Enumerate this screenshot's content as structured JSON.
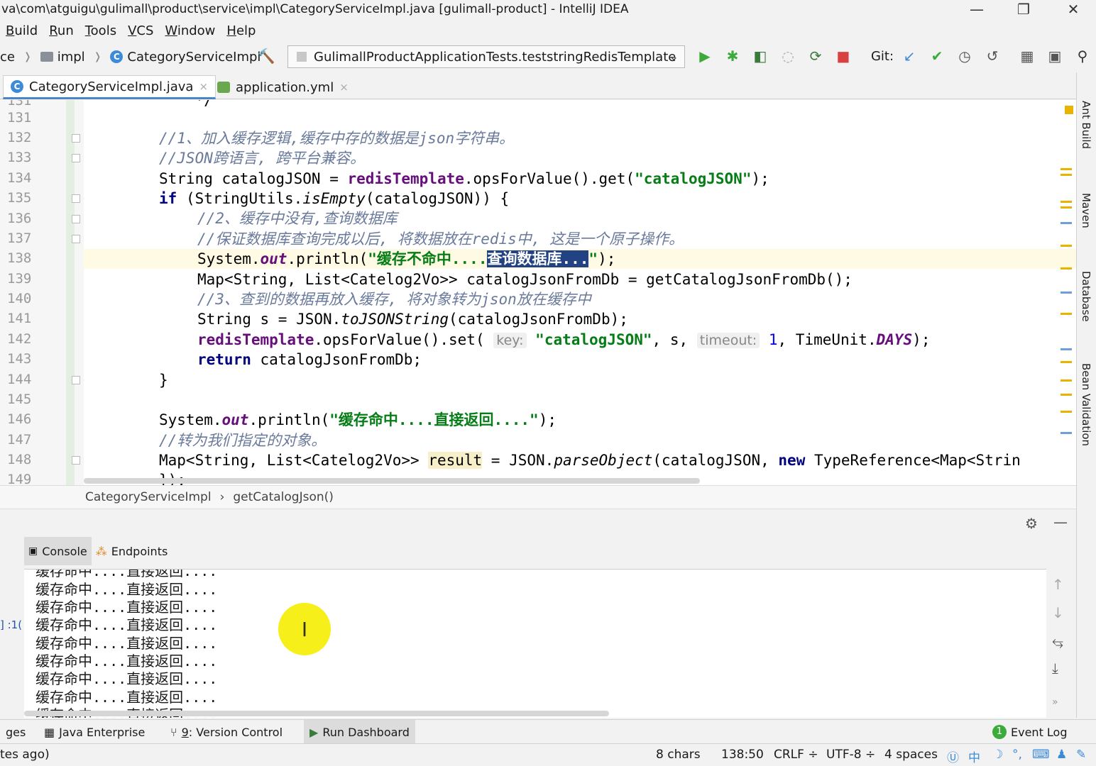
{
  "window": {
    "title": "va\\com\\atguigu\\gulimall\\product\\service\\impl\\CategoryServiceImpl.java [gulimall-product] - IntelliJ IDEA",
    "controls": [
      "—",
      "❐",
      "✕"
    ]
  },
  "menu": [
    {
      "key": "B",
      "rest": "uild"
    },
    {
      "key": "R",
      "rest": "un"
    },
    {
      "key": "T",
      "rest": "ools"
    },
    {
      "key": "V",
      "rest": "CS"
    },
    {
      "key": "W",
      "rest": "indow"
    },
    {
      "key": "H",
      "rest": "elp"
    }
  ],
  "nav": {
    "crumb_prefix": "ce",
    "folder": "impl",
    "class_icon": "C",
    "class": "CategoryServiceImpl",
    "run_config": "GulimallProductApplicationTests.teststringRedisTemplate",
    "git_label": "Git:"
  },
  "tabs": {
    "active": "CategoryServiceImpl.java",
    "second": "application.yml",
    "close": "×"
  },
  "editor": {
    "line_numbers": [
      "131",
      "132",
      "133",
      "134",
      "135",
      "136",
      "137",
      "138",
      "139",
      "140",
      "141",
      "142",
      "143",
      "144",
      "145",
      "146",
      "147",
      "148",
      "149"
    ],
    "l131": "    */",
    "l132": "//1、加入缓存逻辑,缓存中存的数据是json字符串。",
    "l133": "//JSON跨语言, 跨平台兼容。",
    "l134_a": "String catalogJSON = ",
    "l134_b": "redisTemplate",
    "l134_c": ".opsForValue().get(",
    "l134_d": "\"catalogJSON\"",
    "l134_e": ");",
    "l135_a": "if",
    "l135_b": " (StringUtils.",
    "l135_c": "isEmpty",
    "l135_d": "(catalogJSON)) {",
    "l136": "//2、缓存中没有,查询数据库",
    "l137": "//保证数据库查询完成以后, 将数据放在redis中, 这是一个原子操作。",
    "l138_a": "System.",
    "l138_b": "out",
    "l138_c": ".println(",
    "l138_d": "\"缓存不命中....",
    "l138_e": "查询数据库...",
    "l138_f": "\"",
    "l138_g": ");",
    "l139": "Map<String, List<Catelog2Vo>> catalogJsonFromDb = getCatalogJsonFromDb();",
    "l140": "//3、查到的数据再放入缓存, 将对象转为json放在缓存中",
    "l141_a": "String s = JSON.",
    "l141_b": "toJSONString",
    "l141_c": "(catalogJsonFromDb);",
    "l142_a": "redisTemplate",
    "l142_b": ".opsForValue().set( ",
    "l142_hint1": "key:",
    "l142_c": " \"catalogJSON\"",
    "l142_d": ", s, ",
    "l142_hint2": "timeout:",
    "l142_e": " 1",
    "l142_f": ", TimeUnit.",
    "l142_g": "DAYS",
    "l142_h": ");",
    "l143_a": "return",
    "l143_b": " catalogJsonFromDb;",
    "l144": "}",
    "l146_a": "System.",
    "l146_b": "out",
    "l146_c": ".println(",
    "l146_d": "\"缓存命中....直接返回....\"",
    "l146_e": ");",
    "l147": "//转为我们指定的对象。",
    "l148_a": "Map<String, List<Catelog2Vo>> ",
    "l148_b": "result",
    "l148_c": " = JSON.",
    "l148_d": "parseObject",
    "l148_e": "(catalogJSON, ",
    "l148_f": "new",
    "l148_g": " TypeReference<Map<Strin",
    "l149": "});"
  },
  "breadcrumb": {
    "class": "CategoryServiceImpl",
    "sep": "›",
    "method": "getCatalogJson()"
  },
  "run_panel": {
    "tabs": [
      "Console",
      "Endpoints"
    ],
    "left_label": "] :1(",
    "console_lines": [
      "缓存命中....直接返回....",
      "缓存命中....直接返回....",
      "缓存命中....直接返回....",
      "缓存命中....直接返回....",
      "缓存命中....直接返回....",
      "缓存命中....直接返回....",
      "缓存命中....直接返回....",
      "缓存命中....直接返回....",
      "缓存命中....直接返回...."
    ]
  },
  "right_strip": [
    "Ant Build",
    "Maven",
    "Database",
    "Bean Validation"
  ],
  "bottom_tabs": {
    "ges": "ges",
    "java_enterprise": "Java Enterprise",
    "vc_num": "9",
    "vc_rest": ": Version Control",
    "run_dashboard": "Run Dashboard",
    "event_count": "1",
    "event_log": "Event Log"
  },
  "status": {
    "left": "tes ago)",
    "chars": "8 chars",
    "position": "138:50",
    "line_sep": "CRLF ÷",
    "encoding": "UTF-8 ÷",
    "indent": "4 spaces",
    "ime": "中"
  },
  "colors": {
    "accent": "#4a86c7",
    "string": "#067d17",
    "keyword": "#000080",
    "field": "#660e7a",
    "comment": "#6a7a9a",
    "selection": "#214283",
    "run_green": "#3cab3c",
    "stop_red": "#d94040",
    "cursor_highlight": "#f7ef1a"
  }
}
